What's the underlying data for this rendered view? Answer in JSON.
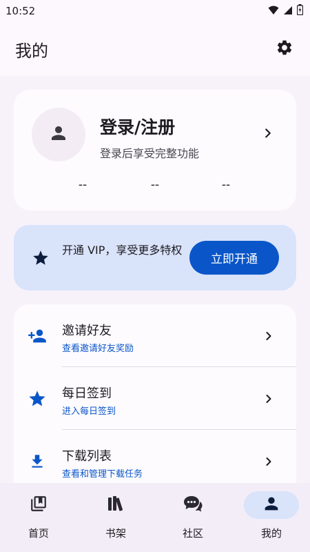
{
  "status_bar": {
    "time": "10:52"
  },
  "header": {
    "title": "我的"
  },
  "profile": {
    "login_title": "登录/注册",
    "login_subtitle": "登录后享受完整功能",
    "stats": [
      "--",
      "--",
      "--"
    ]
  },
  "vip": {
    "text": "开通 VIP，享受更多特权",
    "button_label": "立即开通"
  },
  "menu": [
    {
      "title": "邀请好友",
      "subtitle": "查看邀请好友奖励",
      "icon": "person-add-icon"
    },
    {
      "title": "每日签到",
      "subtitle": "进入每日签到",
      "icon": "star-icon"
    },
    {
      "title": "下载列表",
      "subtitle": "查看和管理下载任务",
      "icon": "download-icon"
    }
  ],
  "nav": [
    {
      "label": "首页",
      "icon": "library-icon",
      "active": false
    },
    {
      "label": "书架",
      "icon": "bookshelf-icon",
      "active": false
    },
    {
      "label": "社区",
      "icon": "chat-bubbles-icon",
      "active": false
    },
    {
      "label": "我的",
      "icon": "person-icon",
      "active": true
    }
  ],
  "colors": {
    "accent": "#0a56c9",
    "vip_bg": "#d9e3fa",
    "page_bg": "#f7f2fa",
    "card_bg": "#fdfbfe",
    "nav_bg": "#f3edf7"
  }
}
